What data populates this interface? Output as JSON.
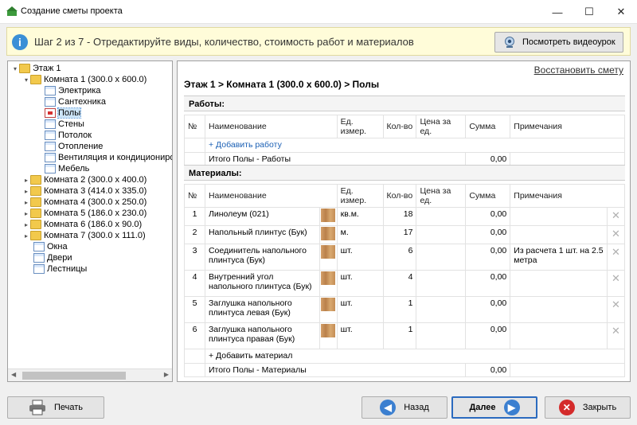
{
  "window": {
    "title": "Создание сметы проекта"
  },
  "banner": {
    "text": "Шаг 2 из 7 - Отредактируйте виды, количество, стоимость работ и материалов",
    "video_label": "Посмотреть видеоурок"
  },
  "tree": {
    "floor": "Этаж 1",
    "room1": "Комната 1 (300.0 x 600.0)",
    "room1_children": [
      "Электрика",
      "Сантехника",
      "Полы",
      "Стены",
      "Потолок",
      "Отопление",
      "Вентиляция и кондиционирование",
      "Мебель"
    ],
    "rooms": [
      "Комната 2 (300.0 x 400.0)",
      "Комната 3 (414.0 x 335.0)",
      "Комната 4 (300.0 x 250.0)",
      "Комната 5 (186.0 x 230.0)",
      "Комната 6 (186.0 x 90.0)",
      "Комната 7 (300.0 x 111.0)"
    ],
    "extras": [
      "Окна",
      "Двери",
      "Лестницы"
    ]
  },
  "main": {
    "restore_label": "Восстановить смету",
    "breadcrumb": "Этаж 1 > Комната 1 (300.0 x 600.0) > Полы",
    "columns": [
      "№",
      "Наименование",
      "Ед. измер.",
      "Кол-во",
      "Цена за ед.",
      "Сумма",
      "Примечания"
    ],
    "works": {
      "header": "Работы:",
      "add_label": "+ Добавить работу",
      "total_label": "Итого Полы - Работы",
      "total_value": "0,00"
    },
    "materials": {
      "header": "Материалы:",
      "rows": [
        {
          "n": "1",
          "name": "Линолеум (021)",
          "unit": "кв.м.",
          "qty": "18",
          "price": "",
          "sum": "0,00",
          "note": ""
        },
        {
          "n": "2",
          "name": "Напольный плинтус (Бук)",
          "unit": "м.",
          "qty": "17",
          "price": "",
          "sum": "0,00",
          "note": ""
        },
        {
          "n": "3",
          "name": "Соединитель напольного плинтуса (Бук)",
          "unit": "шт.",
          "qty": "6",
          "price": "",
          "sum": "0,00",
          "note": "Из расчета 1 шт. на 2.5 метра"
        },
        {
          "n": "4",
          "name": "Внутренний угол напольного плинтуса (Бук)",
          "unit": "шт.",
          "qty": "4",
          "price": "",
          "sum": "0,00",
          "note": ""
        },
        {
          "n": "5",
          "name": "Заглушка напольного плинтуса левая (Бук)",
          "unit": "шт.",
          "qty": "1",
          "price": "",
          "sum": "0,00",
          "note": ""
        },
        {
          "n": "6",
          "name": "Заглушка напольного плинтуса правая (Бук)",
          "unit": "шт.",
          "qty": "1",
          "price": "",
          "sum": "0,00",
          "note": ""
        }
      ],
      "add_label": "+ Добавить материал",
      "total_label": "Итого Полы - Материалы",
      "total_value": "0,00"
    }
  },
  "footer": {
    "print": "Печать",
    "back": "Назад",
    "next": "Далее",
    "close": "Закрыть"
  },
  "colors": {
    "accent": "#1a5fb4",
    "banner_bg": "#fffcd9",
    "selection": "#cce4f7"
  }
}
